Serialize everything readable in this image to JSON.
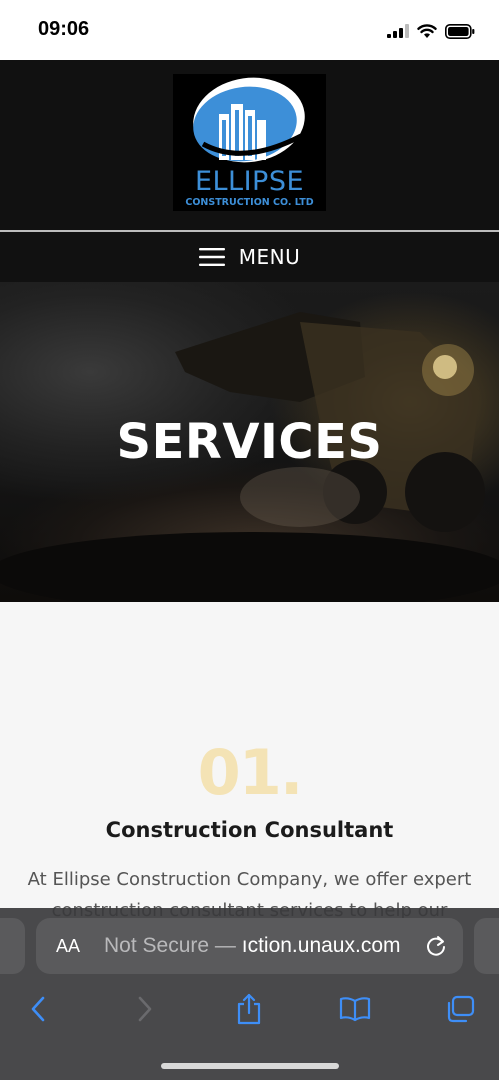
{
  "status_bar": {
    "time": "09:06"
  },
  "header": {
    "logo_name": "ELLIPSE",
    "logo_subtitle": "CONSTRUCTION CO. LTD",
    "menu_label": "MENU"
  },
  "hero": {
    "title": "SERVICES"
  },
  "service": {
    "number": "01.",
    "title": "Construction Consultant",
    "description": "At Ellipse Construction Company, we offer expert construction consultant services to help our clients"
  },
  "browser": {
    "aa_label": "AA",
    "url_security": "Not Secure —",
    "url_domain": "ıction.unaux.com"
  },
  "colors": {
    "accent": "#3d8fd8",
    "number_tint": "#f4e3b5",
    "link_blue": "#3e8ef7"
  }
}
